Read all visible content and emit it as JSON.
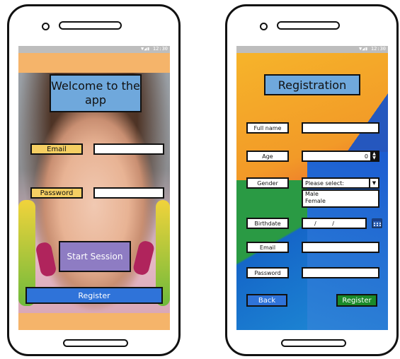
{
  "statusbar": {
    "icons": "▼◢▮",
    "time": "12:30"
  },
  "login": {
    "title": "Welcome to the app",
    "email_label": "Email",
    "email_value": "",
    "password_label": "Password",
    "password_value": "",
    "start_label": "Start Session",
    "register_label": "Register",
    "colors": {
      "band": "#f5b46a",
      "label": "#f5cf63",
      "title": "#6fa8dc",
      "start": "#8e7cc3",
      "register": "#2f73d9"
    }
  },
  "registration": {
    "title": "Registration",
    "fields": {
      "full_name_label": "Full name",
      "age_label": "Age",
      "age_value": "0",
      "gender_label": "Gender",
      "gender_placeholder": "Please select:",
      "gender_options": [
        "Male",
        "Female"
      ],
      "birthdate_label": "Birthdate",
      "birthdate_value": "/ /",
      "email_label": "Email",
      "password_label": "Password"
    },
    "back_label": "Back",
    "register_label": "Register",
    "icons": {
      "stepper": "stepper-icon",
      "dropdown": "chevron-down-icon",
      "calendar": "calendar-icon"
    },
    "colors": {
      "back": "#2f73d9",
      "register": "#1a8a2a"
    }
  }
}
